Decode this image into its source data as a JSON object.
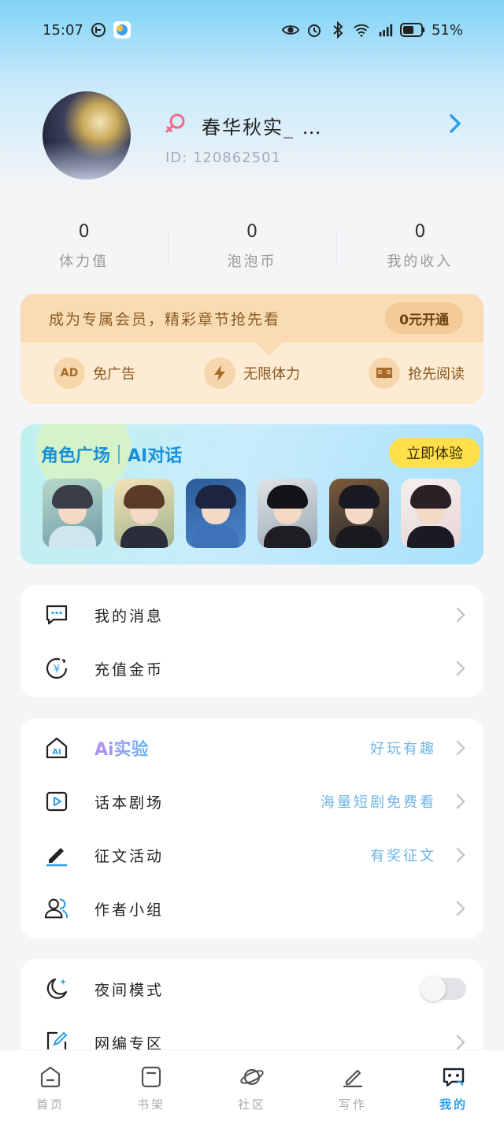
{
  "status_bar": {
    "time": "15:07",
    "battery": "51%",
    "icons": [
      "notification-icon",
      "app-badge-icon",
      "eye-icon",
      "alarm-icon",
      "bluetooth-icon",
      "wifi-icon",
      "cellular-4g-icon",
      "battery-icon"
    ]
  },
  "profile": {
    "username": "春华秋实_ …",
    "user_id": "ID: 120862501",
    "gender_icon": "female-symbol-icon"
  },
  "stats": [
    {
      "value": "0",
      "label": "体力值"
    },
    {
      "value": "0",
      "label": "泡泡币"
    },
    {
      "value": "0",
      "label": "我的收入"
    }
  ],
  "vip": {
    "title": "成为专属会员，精彩章节抢先看",
    "button": "0元开通",
    "perks": [
      {
        "icon_text": "AD",
        "label": "免广告"
      },
      {
        "icon": "lightning-icon",
        "label": "无限体力"
      },
      {
        "icon": "book-icon",
        "label": "抢先阅读"
      }
    ]
  },
  "ai_banner": {
    "title_left": "角色广场",
    "title_right": "AI对话",
    "button": "立即体验"
  },
  "menu_group_1": [
    {
      "label": "我的消息"
    },
    {
      "label": "充值金币"
    }
  ],
  "menu_group_2": [
    {
      "label": "Ai实验",
      "sub": "好玩有趣"
    },
    {
      "label": "话本剧场",
      "sub": "海量短剧免费看"
    },
    {
      "label": "征文活动",
      "sub": "有奖征文"
    },
    {
      "label": "作者小组",
      "sub": ""
    }
  ],
  "menu_group_3": [
    {
      "label": "夜间模式",
      "toggle_on": false
    },
    {
      "label": "网编专区"
    }
  ],
  "bottom_nav": [
    {
      "label": "首页",
      "icon": "home-icon",
      "active": false
    },
    {
      "label": "书架",
      "icon": "bookshelf-icon",
      "active": false
    },
    {
      "label": "社区",
      "icon": "planet-icon",
      "active": false
    },
    {
      "label": "写作",
      "icon": "pen-icon",
      "active": false
    },
    {
      "label": "我的",
      "icon": "chat-bubble-icon",
      "active": true
    }
  ],
  "colors": {
    "accent": "#2a9fe8",
    "vip_text": "#8a5a22",
    "sub_text": "#6fb6e6"
  }
}
